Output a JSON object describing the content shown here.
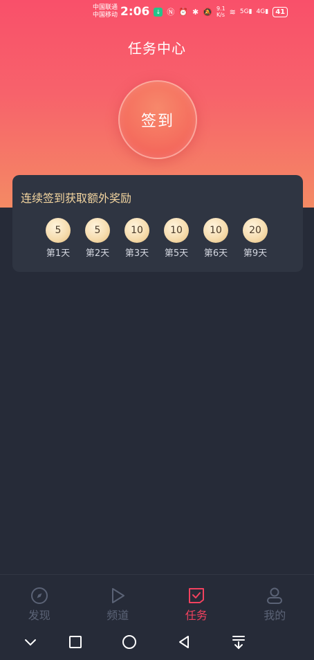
{
  "status_bar": {
    "carrier_1": "中国联通",
    "carrier_2": "中国移动",
    "time": "2:06",
    "net_speed_value": "9.1",
    "net_speed_unit": "K/s",
    "signal_1_label": "5G",
    "signal_2_label": "4G",
    "battery": "41"
  },
  "header": {
    "title": "任务中心"
  },
  "checkin": {
    "label": "签到"
  },
  "rewards": {
    "title": "连续签到获取额外奖励",
    "items": [
      {
        "value": "5",
        "day": "第1天"
      },
      {
        "value": "5",
        "day": "第2天"
      },
      {
        "value": "10",
        "day": "第3天"
      },
      {
        "value": "10",
        "day": "第5天"
      },
      {
        "value": "10",
        "day": "第6天"
      },
      {
        "value": "20",
        "day": "第9天"
      }
    ]
  },
  "tabbar": {
    "active": "task",
    "tabs": [
      {
        "label": "发现",
        "icon": "compass-icon"
      },
      {
        "label": "频道",
        "icon": "play-icon"
      },
      {
        "label": "任务",
        "icon": "task-check-icon"
      },
      {
        "label": "我的",
        "icon": "user-icon"
      }
    ]
  },
  "colors": {
    "accent": "#f2425f",
    "background": "#262b38",
    "card": "#2f3542",
    "gold_text": "#f4d6a0"
  }
}
